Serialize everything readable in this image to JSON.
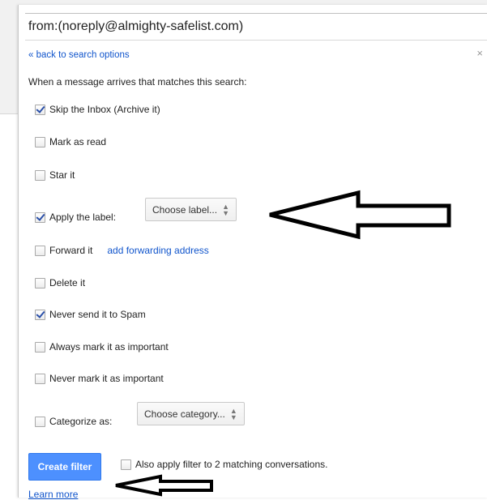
{
  "search": {
    "query": "from:(noreply@almighty-safelist.com)"
  },
  "header": {
    "back_link": "« back to search options",
    "close_icon": "×"
  },
  "instruction": "When a message arrives that matches this search:",
  "options": {
    "skip_inbox": {
      "label": "Skip the Inbox (Archive it)",
      "checked": true
    },
    "mark_read": {
      "label": "Mark as read",
      "checked": false
    },
    "star": {
      "label": "Star it",
      "checked": false
    },
    "apply_label": {
      "label": "Apply the label:",
      "checked": true,
      "select": "Choose label..."
    },
    "forward": {
      "label": "Forward it",
      "checked": false,
      "link": "add forwarding address"
    },
    "delete": {
      "label": "Delete it",
      "checked": false
    },
    "never_spam": {
      "label": "Never send it to Spam",
      "checked": true
    },
    "always_important": {
      "label": "Always mark it as important",
      "checked": false
    },
    "never_important": {
      "label": "Never mark it as important",
      "checked": false
    },
    "categorize": {
      "label": "Categorize as:",
      "checked": false,
      "select": "Choose category..."
    }
  },
  "footer": {
    "create_button": "Create filter",
    "also_apply": {
      "label": "Also apply filter to 2 matching conversations.",
      "checked": false
    },
    "learn_more": "Learn more"
  },
  "colors": {
    "accent": "#4d90fe",
    "link": "#1155cc",
    "check": "#2a4fa8"
  }
}
